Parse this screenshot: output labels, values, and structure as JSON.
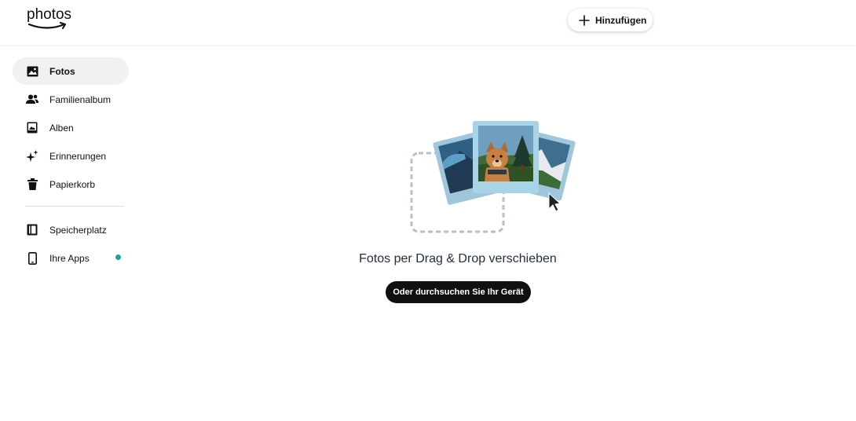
{
  "header": {
    "logo_text": "photos",
    "add_label": "Hinzufügen"
  },
  "sidebar": {
    "items": [
      {
        "label": "Fotos",
        "icon": "photo-icon",
        "active": true
      },
      {
        "label": "Familienalbum",
        "icon": "people-icon"
      },
      {
        "label": "Alben",
        "icon": "album-icon"
      },
      {
        "label": "Erinnerungen",
        "icon": "sparkle-icon"
      },
      {
        "label": "Papierkorb",
        "icon": "trash-icon"
      }
    ],
    "secondary": [
      {
        "label": "Speicherplatz",
        "icon": "storage-icon"
      },
      {
        "label": "Ihre Apps",
        "icon": "phone-icon",
        "badge_color": "#1aa39b"
      }
    ]
  },
  "main": {
    "drop_title": "Fotos per Drag & Drop verschieben",
    "browse_label": "Oder durchsuchen Sie Ihr Gerät"
  },
  "colors": {
    "accent_dot": "#1aa39b",
    "button_dark": "#0f1111",
    "active_bg": "#f0f1f2"
  }
}
